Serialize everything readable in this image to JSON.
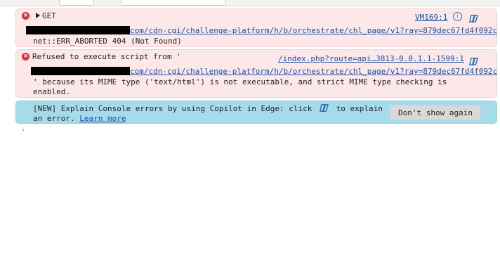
{
  "errors": [
    {
      "method": "GET",
      "source_link": "VM169:1",
      "url_suffix": "com/cdn-cgi/challenge-platform/h/b/orchestrate/chl_page/v1?ray=879dec67fd4f092c",
      "status_text": "net::ERR_ABORTED 404 (Not Found)"
    },
    {
      "message_prefix": "Refused to execute script from '",
      "source_link": "/index.php?route=api…3813-0.0.1.1-1599:1",
      "url_suffix": "com/cdn-cgi/challenge-platform/h/b/orchestrate/chl_page/v1?ray=879dec67fd4f092c",
      "message_line1": "' because its MIME type ('text/html') is not executable, and strict MIME type checking is",
      "message_line2": "enabled."
    }
  ],
  "copilot_banner": {
    "text_part1": "[NEW] Explain Console errors by using Copilot in Edge: click",
    "text_part2": "to explain",
    "text_part3": "an error.",
    "learn_more": "Learn more",
    "dismiss_button": "Don't show again"
  },
  "colors": {
    "error_bg": "#fce8e8",
    "info_bg": "#a6dbe9",
    "link": "#1a4fa3",
    "error_icon": "#d13438"
  }
}
